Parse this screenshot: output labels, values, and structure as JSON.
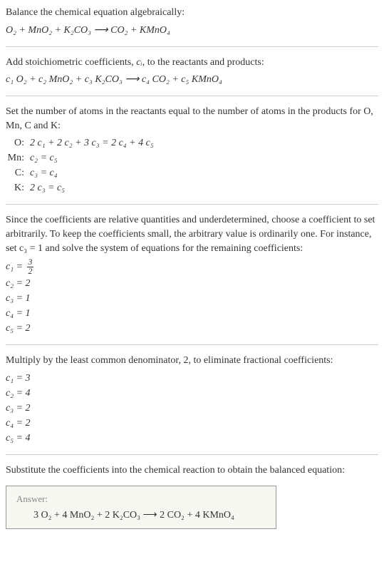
{
  "intro": {
    "line1": "Balance the chemical equation algebraically:",
    "eq": "O₂ + MnO₂ + K₂CO₃  ⟶  CO₂ + KMnO₄"
  },
  "stoich": {
    "line1": "Add stoichiometric coefficients, ",
    "ci": "cᵢ",
    "line2": ", to the reactants and products:",
    "eq_c1": "c₁",
    "eq_r1": " O₂ + ",
    "eq_c2": "c₂",
    "eq_r2": " MnO₂ + ",
    "eq_c3": "c₃",
    "eq_r3": " K₂CO₃  ⟶  ",
    "eq_c4": "c₄",
    "eq_r4": " CO₂ + ",
    "eq_c5": "c₅",
    "eq_r5": " KMnO₄"
  },
  "atoms": {
    "intro": "Set the number of atoms in the reactants equal to the number of atoms in the products for O, Mn, C and K:",
    "rows": [
      {
        "label": "O:",
        "eq": "2 c₁ + 2 c₂ + 3 c₃ = 2 c₄ + 4 c₅"
      },
      {
        "label": "Mn:",
        "eq": "c₂ = c₅"
      },
      {
        "label": "C:",
        "eq": "c₃ = c₄"
      },
      {
        "label": "K:",
        "eq": "2 c₃ = c₅"
      }
    ]
  },
  "arbitrary": {
    "text": "Since the coefficients are relative quantities and underdetermined, choose a coefficient to set arbitrarily. To keep the coefficients small, the arbitrary value is ordinarily one. For instance, set c₃ = 1 and solve the system of equations for the remaining coefficients:",
    "c1_lhs": "c₁ = ",
    "c1_num": "3",
    "c1_den": "2",
    "lines": [
      "c₂ = 2",
      "c₃ = 1",
      "c₄ = 1",
      "c₅ = 2"
    ]
  },
  "multiply": {
    "text": "Multiply by the least common denominator, 2, to eliminate fractional coefficients:",
    "lines": [
      "c₁ = 3",
      "c₂ = 4",
      "c₃ = 2",
      "c₄ = 2",
      "c₅ = 4"
    ]
  },
  "substitute": {
    "text": "Substitute the coefficients into the chemical reaction to obtain the balanced equation:"
  },
  "answer": {
    "label": "Answer:",
    "eq": "3 O₂ + 4 MnO₂ + 2 K₂CO₃  ⟶  2 CO₂ + 4 KMnO₄"
  }
}
